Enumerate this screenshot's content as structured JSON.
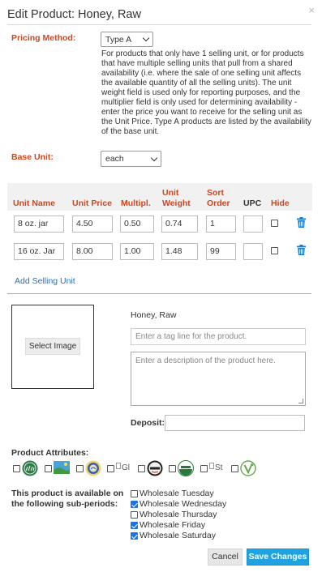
{
  "dialog": {
    "title": "Edit Product: Honey, Raw",
    "close_glyph": "×"
  },
  "pricing": {
    "label": "Pricing Method:",
    "selected": "Type A",
    "description": "For products that only have 1 selling unit, or for products that have multiple selling units that pull from a shared availability (i.e. where the sale of one selling unit affects the available quantity of all the selling units). The unit weight field is used only for reporting purposes, and the multiplier field is only used for determining availability - enter the price you want to receive for the selling unit as the Unit Price. Type A products are listed by the availability of the base unit."
  },
  "base_unit": {
    "label": "Base Unit:",
    "selected": "each"
  },
  "units_table": {
    "headers": {
      "unit_name": "Unit Name",
      "unit_price": "Unit Price",
      "multiplier": "Multipl.",
      "unit_weight_1": "Unit",
      "unit_weight_2": "Weight",
      "sort_1": "Sort",
      "sort_2": "Order",
      "upc": "UPC",
      "hide": "Hide"
    },
    "rows": [
      {
        "name": "8 oz. jar",
        "price": "4.50",
        "multiplier": "0.50",
        "weight": "0.74",
        "sort": "1",
        "upc": "",
        "hidden": false
      },
      {
        "name": "16 oz. Jar",
        "price": "8.00",
        "multiplier": "1.00",
        "weight": "1.48",
        "sort": "99",
        "upc": "",
        "hidden": false
      }
    ]
  },
  "add_selling_unit": "Add Selling Unit",
  "image": {
    "select_button": "Select Image"
  },
  "product": {
    "name": "Honey, Raw",
    "tagline_placeholder": "Enter a tag line for the product.",
    "description_placeholder": "Enter a description of the product here.",
    "deposit_label": "Deposit:",
    "deposit_value": ""
  },
  "attributes": {
    "label": "Product Attributes:",
    "items": [
      {
        "icon": "grass-fed-badge-icon",
        "checked": false
      },
      {
        "icon": "pasture-raised-badge-icon",
        "checked": false
      },
      {
        "icon": "certified-seal-badge-icon",
        "checked": false
      },
      {
        "icon": "gluten-free-badge-icon",
        "alt": "Gl",
        "checked": false
      },
      {
        "icon": "animal-welfare-badge-icon",
        "checked": false
      },
      {
        "icon": "usda-organic-badge-icon",
        "checked": false
      },
      {
        "icon": "broken-image-icon",
        "alt": "St",
        "checked": false
      },
      {
        "icon": "vegan-badge-icon",
        "checked": false
      }
    ]
  },
  "subperiods": {
    "label": "This product is available on the following sub-periods:",
    "items": [
      {
        "label": "Wholesale Tuesday",
        "checked": false
      },
      {
        "label": "Wholesale Wednesday",
        "checked": true
      },
      {
        "label": "Wholesale Thursday",
        "checked": false
      },
      {
        "label": "Wholesale Friday",
        "checked": true
      },
      {
        "label": "Wholesale Saturday",
        "checked": true
      }
    ]
  },
  "footer": {
    "cancel": "Cancel",
    "save": "Save Changes"
  },
  "colors": {
    "label_red": "#d2451c",
    "link_blue": "#2672b8",
    "save_blue": "#1fa2e2",
    "check_blue": "#1a73e8"
  }
}
